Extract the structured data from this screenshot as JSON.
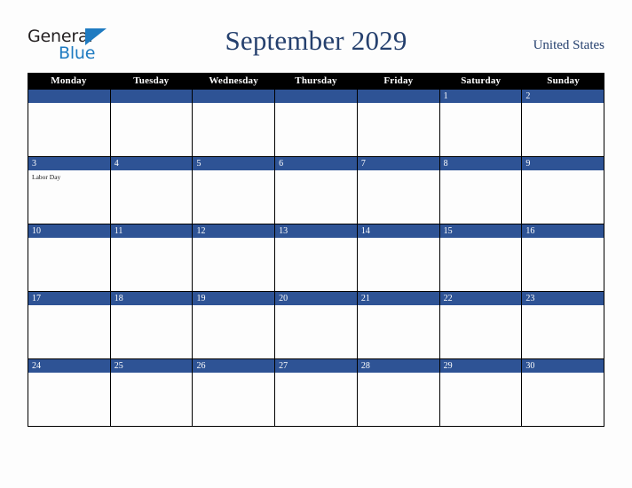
{
  "logo": {
    "word_one": "General",
    "word_two": "Blue",
    "triangle_icon": "triangle-icon",
    "brand_dark": "#231f20",
    "brand_blue": "#1f7bc1"
  },
  "header": {
    "title": "September 2029",
    "country": "United States",
    "title_color": "#25406e"
  },
  "calendar": {
    "weekdays": [
      "Monday",
      "Tuesday",
      "Wednesday",
      "Thursday",
      "Friday",
      "Saturday",
      "Sunday"
    ],
    "header_bg": "#000000",
    "date_band_bg": "#2e5395",
    "cell_bg": "#fdfdfd",
    "weeks": [
      [
        {
          "date": "",
          "events": []
        },
        {
          "date": "",
          "events": []
        },
        {
          "date": "",
          "events": []
        },
        {
          "date": "",
          "events": []
        },
        {
          "date": "",
          "events": []
        },
        {
          "date": "1",
          "events": []
        },
        {
          "date": "2",
          "events": []
        }
      ],
      [
        {
          "date": "3",
          "events": [
            "Labor Day"
          ]
        },
        {
          "date": "4",
          "events": []
        },
        {
          "date": "5",
          "events": []
        },
        {
          "date": "6",
          "events": []
        },
        {
          "date": "7",
          "events": []
        },
        {
          "date": "8",
          "events": []
        },
        {
          "date": "9",
          "events": []
        }
      ],
      [
        {
          "date": "10",
          "events": []
        },
        {
          "date": "11",
          "events": []
        },
        {
          "date": "12",
          "events": []
        },
        {
          "date": "13",
          "events": []
        },
        {
          "date": "14",
          "events": []
        },
        {
          "date": "15",
          "events": []
        },
        {
          "date": "16",
          "events": []
        }
      ],
      [
        {
          "date": "17",
          "events": []
        },
        {
          "date": "18",
          "events": []
        },
        {
          "date": "19",
          "events": []
        },
        {
          "date": "20",
          "events": []
        },
        {
          "date": "21",
          "events": []
        },
        {
          "date": "22",
          "events": []
        },
        {
          "date": "23",
          "events": []
        }
      ],
      [
        {
          "date": "24",
          "events": []
        },
        {
          "date": "25",
          "events": []
        },
        {
          "date": "26",
          "events": []
        },
        {
          "date": "27",
          "events": []
        },
        {
          "date": "28",
          "events": []
        },
        {
          "date": "29",
          "events": []
        },
        {
          "date": "30",
          "events": []
        }
      ]
    ]
  }
}
